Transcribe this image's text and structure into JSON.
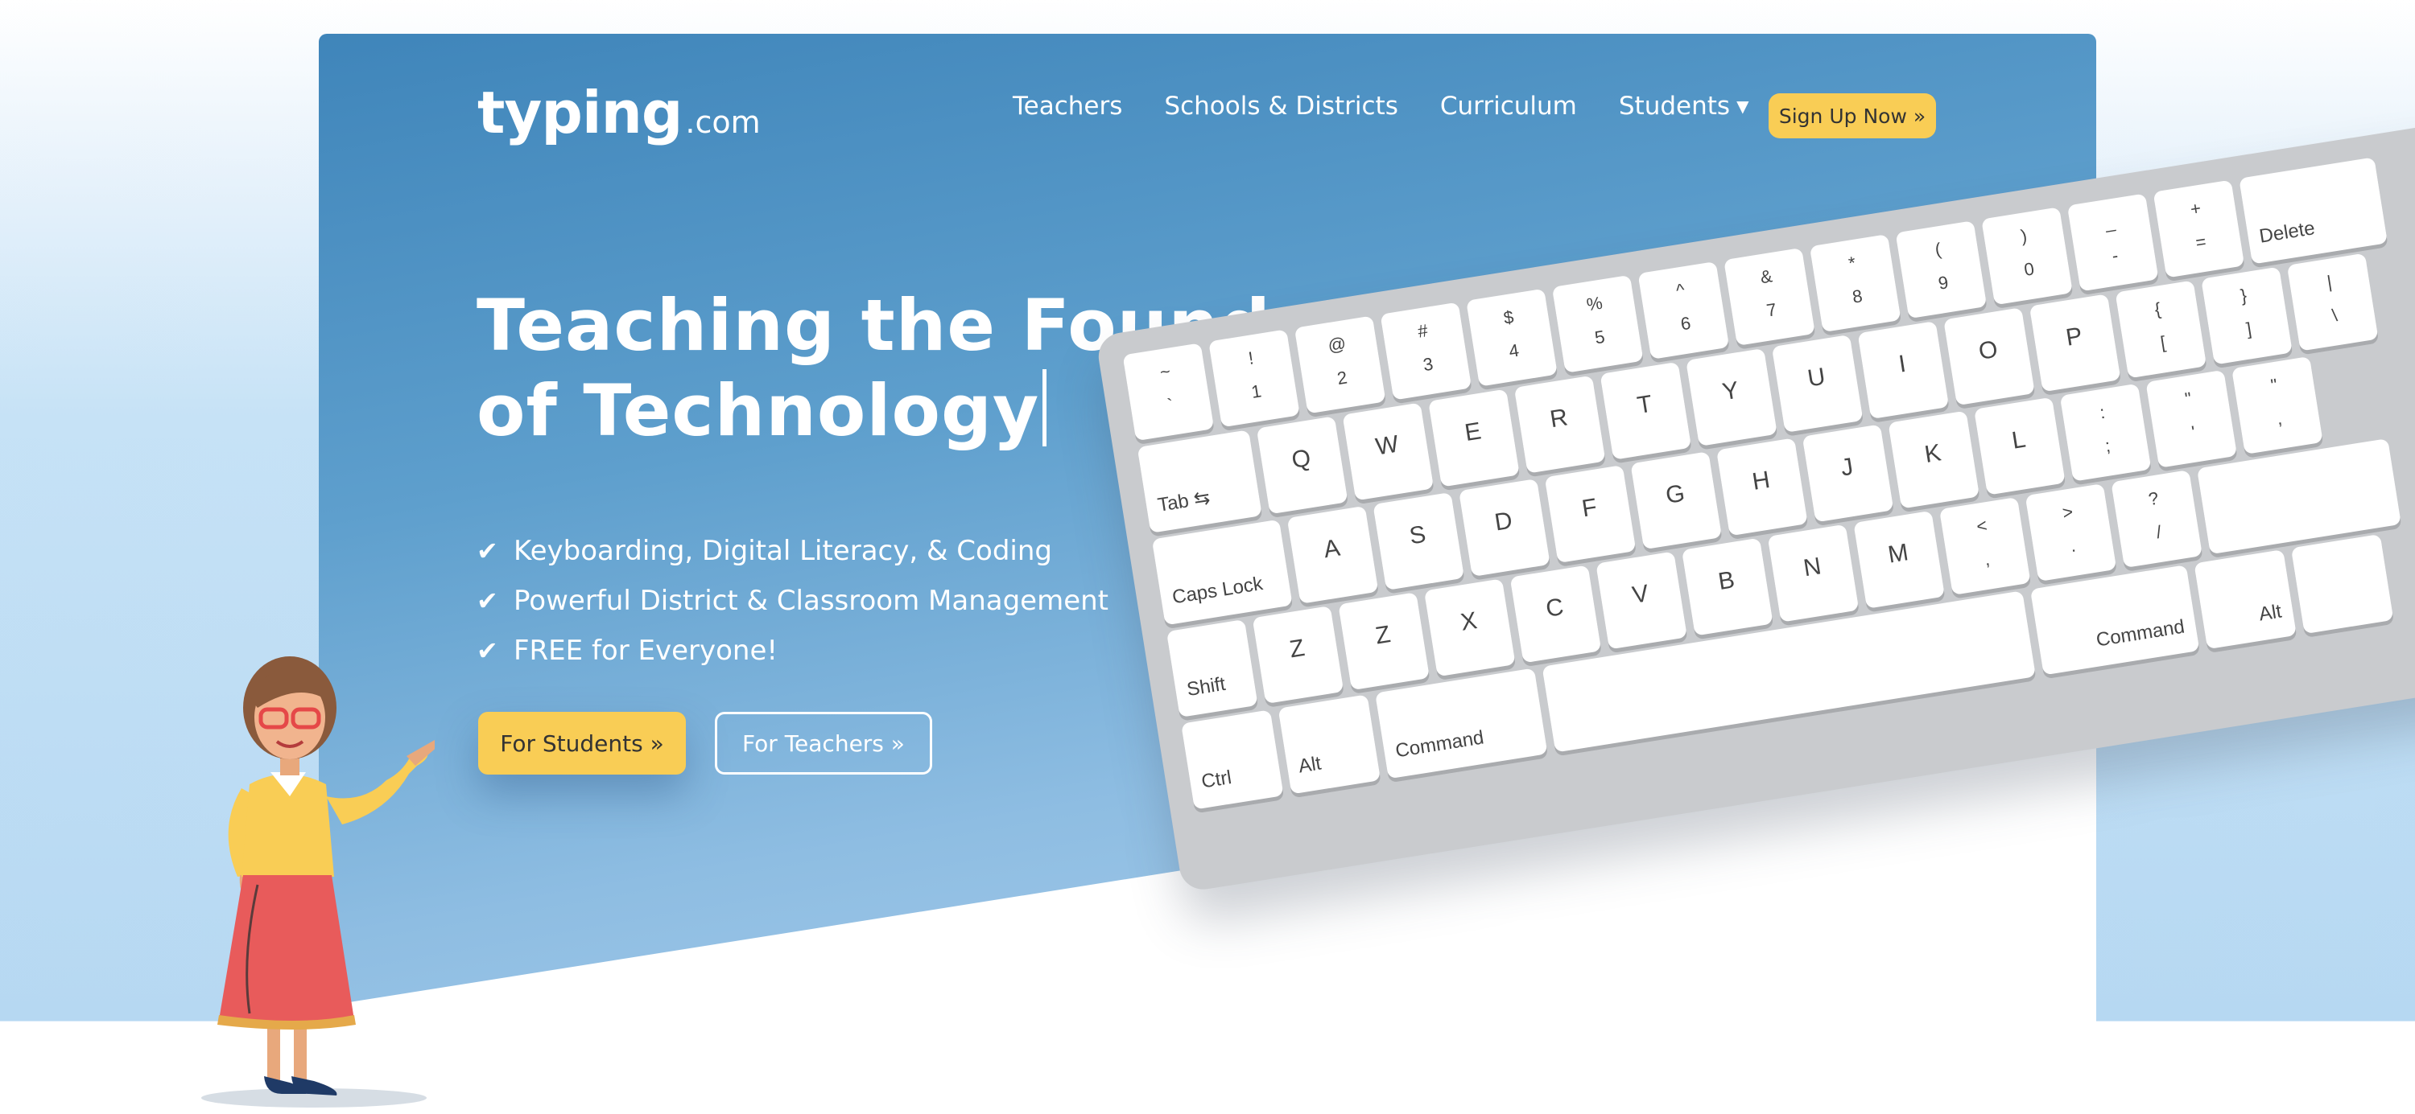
{
  "header": {
    "logo_main": "typing",
    "logo_tld": ".com",
    "nav": [
      "Teachers",
      "Schools & Districts",
      "Curriculum"
    ],
    "students_label": "Students",
    "signup_label": "Sign Up Now »"
  },
  "hero": {
    "headline_line1": "Teaching the Foundations",
    "headline_line2": "of Technology",
    "features": [
      "Keyboarding, Digital Literacy, & Coding",
      "Powerful District & Classroom Management",
      "FREE for Everyone!"
    ],
    "students_button": "For Students »",
    "teachers_button": "For Teachers »"
  },
  "keyboard": {
    "row1": [
      {
        "up": "~",
        "down": "`"
      },
      {
        "up": "!",
        "down": "1"
      },
      {
        "up": "@",
        "down": "2"
      },
      {
        "up": "#",
        "down": "3"
      },
      {
        "up": "$",
        "down": "4"
      },
      {
        "up": "%",
        "down": "5"
      },
      {
        "up": "^",
        "down": "6"
      },
      {
        "up": "&",
        "down": "7"
      },
      {
        "up": "*",
        "down": "8"
      },
      {
        "up": "(",
        "down": "9"
      },
      {
        "up": ")",
        "down": "0"
      },
      {
        "up": "_",
        "down": "-"
      },
      {
        "up": "+",
        "down": "="
      }
    ],
    "delete": "Delete",
    "tab": "Tab ⇆",
    "row2": [
      "Q",
      "W",
      "E",
      "R",
      "T",
      "Y",
      "U",
      "I",
      "O",
      "P"
    ],
    "row2_sym": [
      {
        "up": "{",
        "down": "["
      },
      {
        "up": "}",
        "down": "]"
      },
      {
        "up": "|",
        "down": "\\"
      }
    ],
    "caps": "Caps Lock",
    "row3": [
      "A",
      "S",
      "D",
      "F",
      "G",
      "H",
      "J",
      "K",
      "L"
    ],
    "row3_sym": [
      {
        "up": ":",
        "down": ";"
      },
      {
        "up": "\"",
        "down": "'"
      },
      {
        "up": "\"",
        "down": ","
      }
    ],
    "shift": "Shift",
    "row4": [
      "Z",
      "Z",
      "X",
      "C",
      "V",
      "B",
      "N",
      "M"
    ],
    "row4_sym": [
      {
        "up": "<",
        "down": ","
      },
      {
        "up": ">",
        "down": "."
      },
      {
        "up": "?",
        "down": "/"
      }
    ],
    "ctrl": "Ctrl",
    "alt": "Alt",
    "command": "Command"
  },
  "colors": {
    "brand_blue": "#4a8cc0",
    "accent_yellow": "#f9cd55"
  }
}
